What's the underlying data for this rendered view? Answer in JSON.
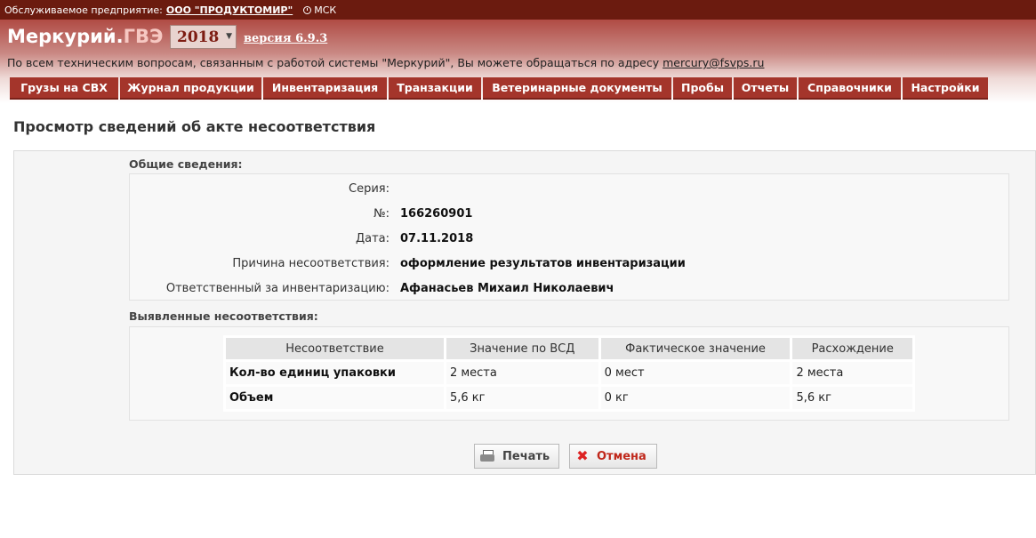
{
  "topbar": {
    "label": "Обслуживаемое предприятие:",
    "org": "ООО \"ПРОДУКТОМИР\"",
    "timezone": "МСК"
  },
  "header": {
    "logo_main": "Меркурий.",
    "logo_suffix": "ГВЭ",
    "year": "2018",
    "version": "версия 6.9.3",
    "support_text": "По всем техническим вопросам, связанным с работой системы \"Меркурий\", Вы можете обращаться по адресу",
    "support_email": "mercury@fsvps.ru"
  },
  "nav": [
    "Грузы на СВХ",
    "Журнал продукции",
    "Инвентаризация",
    "Транзакции",
    "Ветеринарные документы",
    "Пробы",
    "Отчеты",
    "Справочники",
    "Настройки"
  ],
  "page_title": "Просмотр сведений об акте несоответствия",
  "general": {
    "section_label": "Общие сведения:",
    "rows": [
      {
        "label": "Серия:",
        "value": ""
      },
      {
        "label": "№:",
        "value": "166260901"
      },
      {
        "label": "Дата:",
        "value": "07.11.2018"
      },
      {
        "label": "Причина несоответствия:",
        "value": "оформление результатов инвентаризации"
      },
      {
        "label": "Ответственный за инвентаризацию:",
        "value": "Афанасьев Михаил Николаевич"
      }
    ]
  },
  "discrepancies": {
    "section_label": "Выявленные несоответствия:",
    "columns": [
      "Несоответствие",
      "Значение по ВСД",
      "Фактическое значение",
      "Расхождение"
    ],
    "rows": [
      [
        "Кол-во единиц упаковки",
        "2 места",
        "0 мест",
        "2 места"
      ],
      [
        "Объем",
        "5,6 кг",
        "0 кг",
        "5,6 кг"
      ]
    ]
  },
  "buttons": {
    "print": "Печать",
    "cancel": "Отмена"
  }
}
